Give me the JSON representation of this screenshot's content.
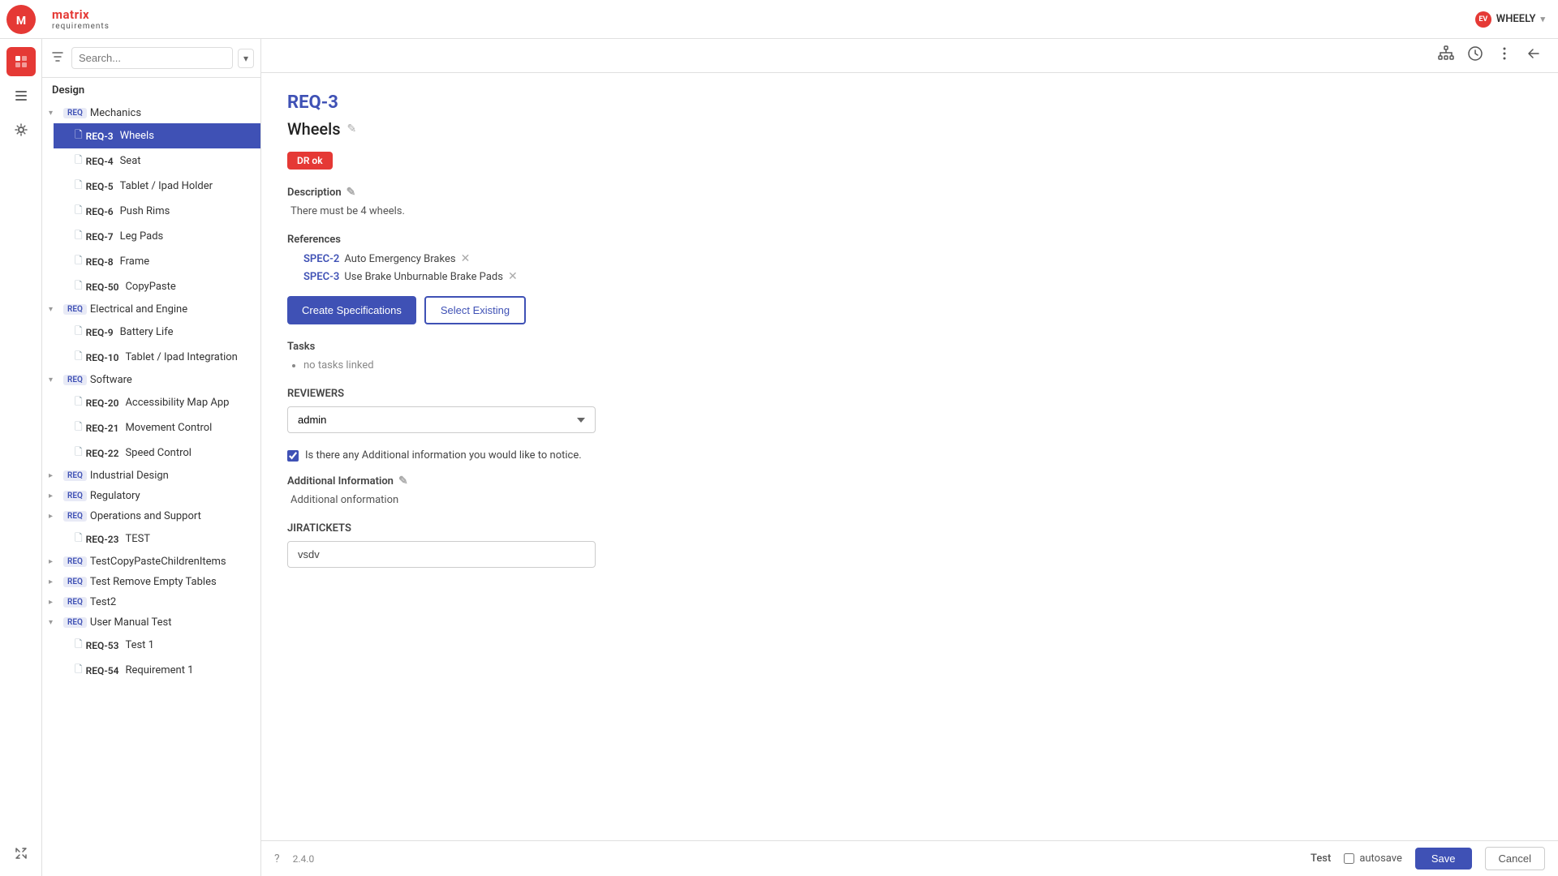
{
  "app": {
    "version": "2.4.0",
    "brand": "WHEELY",
    "env": "Test"
  },
  "header": {
    "search_placeholder": "Search...",
    "section": "Design"
  },
  "record": {
    "id": "REQ-3",
    "title": "Wheels",
    "status": "DR ok",
    "description_label": "Description",
    "description_text": "There must be 4 wheels.",
    "references_label": "References",
    "references": [
      {
        "id": "SPEC-2",
        "text": "Auto Emergency Brakes"
      },
      {
        "id": "SPEC-3",
        "text": "Use Brake Unburnable Brake Pads"
      }
    ],
    "create_spec_label": "Create Specifications",
    "select_existing_label": "Select Existing",
    "tasks_label": "Tasks",
    "tasks_empty": "no tasks linked",
    "reviewers_label": "REVIEWERS",
    "reviewer_value": "admin",
    "additional_checkbox_label": "Is there any Additional information you would like to notice.",
    "additional_info_label": "Additional Information",
    "additional_info_text": "Additional onformation",
    "jira_label": "JIRATICKETS",
    "jira_value": "vsdv"
  },
  "sidebar": {
    "groups": [
      {
        "label": "REQ",
        "name": "Mechanics",
        "expanded": true,
        "children": [
          {
            "id": "REQ-3",
            "name": "Wheels",
            "active": true
          },
          {
            "id": "REQ-4",
            "name": "Seat"
          },
          {
            "id": "REQ-5",
            "name": "Tablet / Ipad Holder"
          },
          {
            "id": "REQ-6",
            "name": "Push Rims"
          },
          {
            "id": "REQ-7",
            "name": "Leg Pads"
          },
          {
            "id": "REQ-8",
            "name": "Frame"
          },
          {
            "id": "REQ-50",
            "name": "CopyPaste"
          }
        ]
      },
      {
        "label": "REQ",
        "name": "Electrical and Engine",
        "expanded": true,
        "children": [
          {
            "id": "REQ-9",
            "name": "Battery Life"
          },
          {
            "id": "REQ-10",
            "name": "Tablet / Ipad Integration"
          }
        ]
      },
      {
        "label": "REQ",
        "name": "Software",
        "expanded": true,
        "children": [
          {
            "id": "REQ-20",
            "name": "Accessibility Map App"
          },
          {
            "id": "REQ-21",
            "name": "Movement Control"
          },
          {
            "id": "REQ-22",
            "name": "Speed Control"
          }
        ]
      },
      {
        "label": "REQ",
        "name": "Industrial Design",
        "expanded": false,
        "children": []
      },
      {
        "label": "REQ",
        "name": "Regulatory",
        "expanded": false,
        "children": []
      },
      {
        "label": "REQ",
        "name": "Operations and Support",
        "expanded": false,
        "children": [
          {
            "id": "REQ-23",
            "name": "TEST"
          }
        ]
      },
      {
        "label": "REQ",
        "name": "TestCopyPasteChildrenItems",
        "expanded": false,
        "children": []
      },
      {
        "label": "REQ",
        "name": "Test Remove Empty Tables",
        "expanded": false,
        "children": []
      },
      {
        "label": "REQ",
        "name": "Test2",
        "expanded": false,
        "children": []
      },
      {
        "label": "REQ",
        "name": "User Manual Test",
        "expanded": true,
        "children": [
          {
            "id": "REQ-53",
            "name": "Test 1"
          },
          {
            "id": "REQ-54",
            "name": "Requirement 1"
          }
        ]
      }
    ]
  },
  "footer": {
    "save_label": "Save",
    "cancel_label": "Cancel",
    "autosave_label": "autosave",
    "version": "2.4.0",
    "env": "Test"
  },
  "icons": {
    "filter": "⚙",
    "chevron_down": "▾",
    "chevron_right": "▸",
    "doc": "🗋",
    "edit": "✎",
    "remove": "✕",
    "tree_icon": "🌿",
    "history": "⏱",
    "more": "⋮",
    "back": "←",
    "help": "?"
  }
}
